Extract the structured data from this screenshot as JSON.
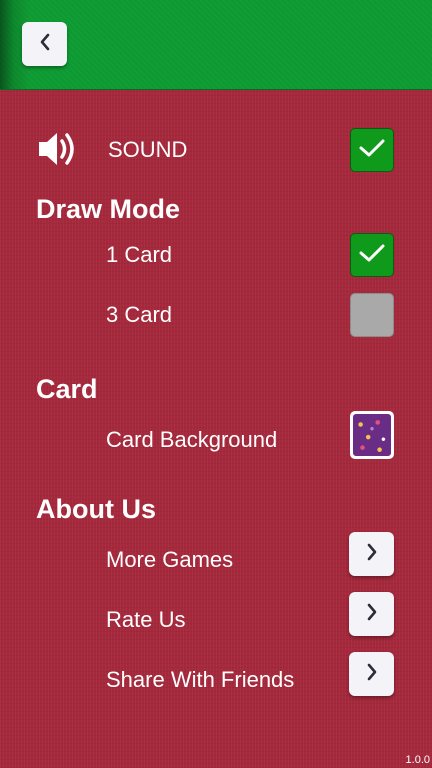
{
  "header": {
    "back_icon": "chevron-left-icon"
  },
  "sound": {
    "icon": "speaker-icon",
    "label": "SOUND",
    "checked": true
  },
  "draw_mode": {
    "title": "Draw Mode",
    "options": [
      {
        "label": "1 Card",
        "checked": true
      },
      {
        "label": "3 Card",
        "checked": false
      }
    ]
  },
  "card": {
    "title": "Card",
    "background_label": "Card Background"
  },
  "about": {
    "title": "About Us",
    "items": [
      {
        "label": "More Games",
        "icon": "chevron-right-icon"
      },
      {
        "label": "Rate Us",
        "icon": "chevron-right-icon"
      },
      {
        "label": "Share With Friends",
        "icon": "chevron-right-icon"
      }
    ]
  },
  "version": "1.0.0",
  "colors": {
    "header_green": "#0e9a32",
    "background_red": "#a5283c",
    "check_green": "#109a1c",
    "unchecked_gray": "#a9a9a9"
  }
}
